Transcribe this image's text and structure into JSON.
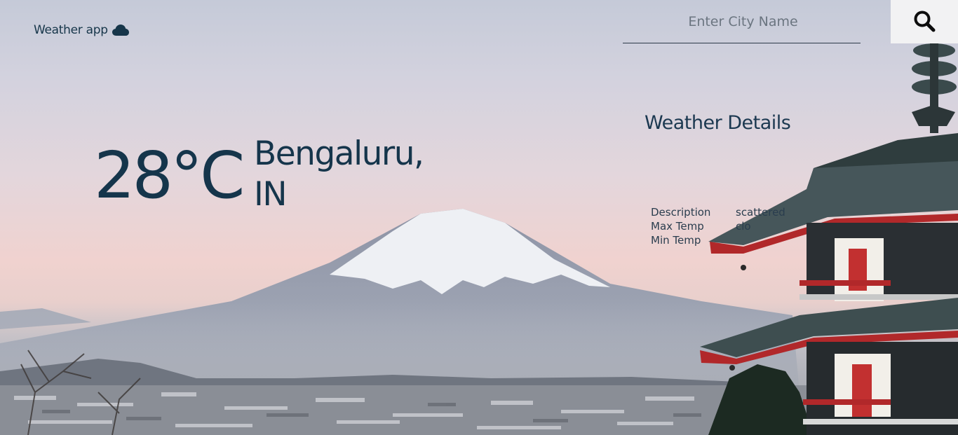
{
  "app": {
    "title": "Weather app",
    "title_icon": "cloud-icon"
  },
  "search": {
    "placeholder": "Enter City Name",
    "button_icon": "search-icon"
  },
  "current": {
    "temperature": "28°C",
    "city_line1": "Bengaluru,",
    "city_line2": "IN"
  },
  "details": {
    "title": "Weather Details",
    "rows": [
      {
        "label": "Description",
        "value": "scattered"
      },
      {
        "label": "Max Temp",
        "value": "clo"
      },
      {
        "label": "Min Temp",
        "value": ""
      }
    ]
  },
  "colors": {
    "text_primary": "#15354b",
    "search_button_bg": "#f2f2f3"
  }
}
